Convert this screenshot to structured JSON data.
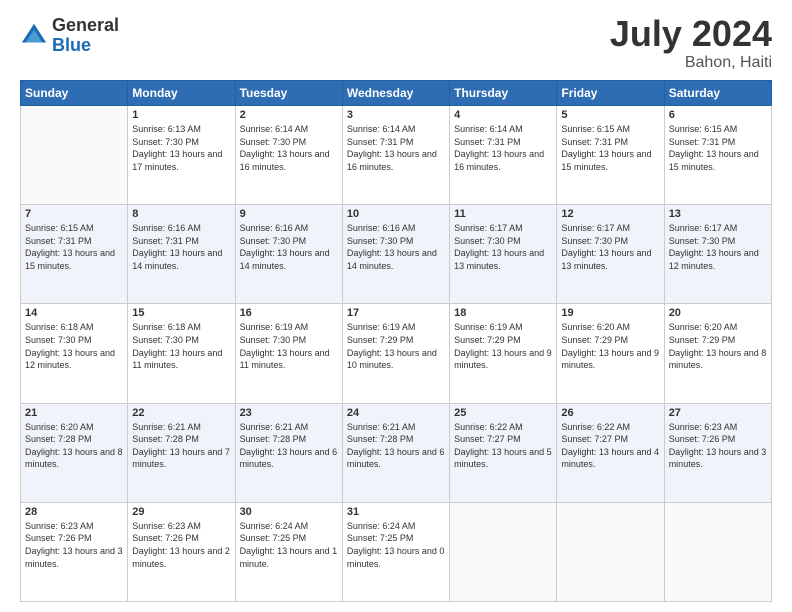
{
  "header": {
    "logo_general": "General",
    "logo_blue": "Blue",
    "title": "July 2024",
    "location": "Bahon, Haiti"
  },
  "days_of_week": [
    "Sunday",
    "Monday",
    "Tuesday",
    "Wednesday",
    "Thursday",
    "Friday",
    "Saturday"
  ],
  "weeks": [
    [
      {
        "day": "",
        "sunrise": "",
        "sunset": "",
        "daylight": ""
      },
      {
        "day": "1",
        "sunrise": "6:13 AM",
        "sunset": "7:30 PM",
        "daylight": "13 hours and 17 minutes."
      },
      {
        "day": "2",
        "sunrise": "6:14 AM",
        "sunset": "7:30 PM",
        "daylight": "13 hours and 16 minutes."
      },
      {
        "day": "3",
        "sunrise": "6:14 AM",
        "sunset": "7:31 PM",
        "daylight": "13 hours and 16 minutes."
      },
      {
        "day": "4",
        "sunrise": "6:14 AM",
        "sunset": "7:31 PM",
        "daylight": "13 hours and 16 minutes."
      },
      {
        "day": "5",
        "sunrise": "6:15 AM",
        "sunset": "7:31 PM",
        "daylight": "13 hours and 15 minutes."
      },
      {
        "day": "6",
        "sunrise": "6:15 AM",
        "sunset": "7:31 PM",
        "daylight": "13 hours and 15 minutes."
      }
    ],
    [
      {
        "day": "7",
        "sunrise": "6:15 AM",
        "sunset": "7:31 PM",
        "daylight": "13 hours and 15 minutes."
      },
      {
        "day": "8",
        "sunrise": "6:16 AM",
        "sunset": "7:31 PM",
        "daylight": "13 hours and 14 minutes."
      },
      {
        "day": "9",
        "sunrise": "6:16 AM",
        "sunset": "7:30 PM",
        "daylight": "13 hours and 14 minutes."
      },
      {
        "day": "10",
        "sunrise": "6:16 AM",
        "sunset": "7:30 PM",
        "daylight": "13 hours and 14 minutes."
      },
      {
        "day": "11",
        "sunrise": "6:17 AM",
        "sunset": "7:30 PM",
        "daylight": "13 hours and 13 minutes."
      },
      {
        "day": "12",
        "sunrise": "6:17 AM",
        "sunset": "7:30 PM",
        "daylight": "13 hours and 13 minutes."
      },
      {
        "day": "13",
        "sunrise": "6:17 AM",
        "sunset": "7:30 PM",
        "daylight": "13 hours and 12 minutes."
      }
    ],
    [
      {
        "day": "14",
        "sunrise": "6:18 AM",
        "sunset": "7:30 PM",
        "daylight": "13 hours and 12 minutes."
      },
      {
        "day": "15",
        "sunrise": "6:18 AM",
        "sunset": "7:30 PM",
        "daylight": "13 hours and 11 minutes."
      },
      {
        "day": "16",
        "sunrise": "6:19 AM",
        "sunset": "7:30 PM",
        "daylight": "13 hours and 11 minutes."
      },
      {
        "day": "17",
        "sunrise": "6:19 AM",
        "sunset": "7:29 PM",
        "daylight": "13 hours and 10 minutes."
      },
      {
        "day": "18",
        "sunrise": "6:19 AM",
        "sunset": "7:29 PM",
        "daylight": "13 hours and 9 minutes."
      },
      {
        "day": "19",
        "sunrise": "6:20 AM",
        "sunset": "7:29 PM",
        "daylight": "13 hours and 9 minutes."
      },
      {
        "day": "20",
        "sunrise": "6:20 AM",
        "sunset": "7:29 PM",
        "daylight": "13 hours and 8 minutes."
      }
    ],
    [
      {
        "day": "21",
        "sunrise": "6:20 AM",
        "sunset": "7:28 PM",
        "daylight": "13 hours and 8 minutes."
      },
      {
        "day": "22",
        "sunrise": "6:21 AM",
        "sunset": "7:28 PM",
        "daylight": "13 hours and 7 minutes."
      },
      {
        "day": "23",
        "sunrise": "6:21 AM",
        "sunset": "7:28 PM",
        "daylight": "13 hours and 6 minutes."
      },
      {
        "day": "24",
        "sunrise": "6:21 AM",
        "sunset": "7:28 PM",
        "daylight": "13 hours and 6 minutes."
      },
      {
        "day": "25",
        "sunrise": "6:22 AM",
        "sunset": "7:27 PM",
        "daylight": "13 hours and 5 minutes."
      },
      {
        "day": "26",
        "sunrise": "6:22 AM",
        "sunset": "7:27 PM",
        "daylight": "13 hours and 4 minutes."
      },
      {
        "day": "27",
        "sunrise": "6:23 AM",
        "sunset": "7:26 PM",
        "daylight": "13 hours and 3 minutes."
      }
    ],
    [
      {
        "day": "28",
        "sunrise": "6:23 AM",
        "sunset": "7:26 PM",
        "daylight": "13 hours and 3 minutes."
      },
      {
        "day": "29",
        "sunrise": "6:23 AM",
        "sunset": "7:26 PM",
        "daylight": "13 hours and 2 minutes."
      },
      {
        "day": "30",
        "sunrise": "6:24 AM",
        "sunset": "7:25 PM",
        "daylight": "13 hours and 1 minute."
      },
      {
        "day": "31",
        "sunrise": "6:24 AM",
        "sunset": "7:25 PM",
        "daylight": "13 hours and 0 minutes."
      },
      {
        "day": "",
        "sunrise": "",
        "sunset": "",
        "daylight": ""
      },
      {
        "day": "",
        "sunrise": "",
        "sunset": "",
        "daylight": ""
      },
      {
        "day": "",
        "sunrise": "",
        "sunset": "",
        "daylight": ""
      }
    ]
  ]
}
